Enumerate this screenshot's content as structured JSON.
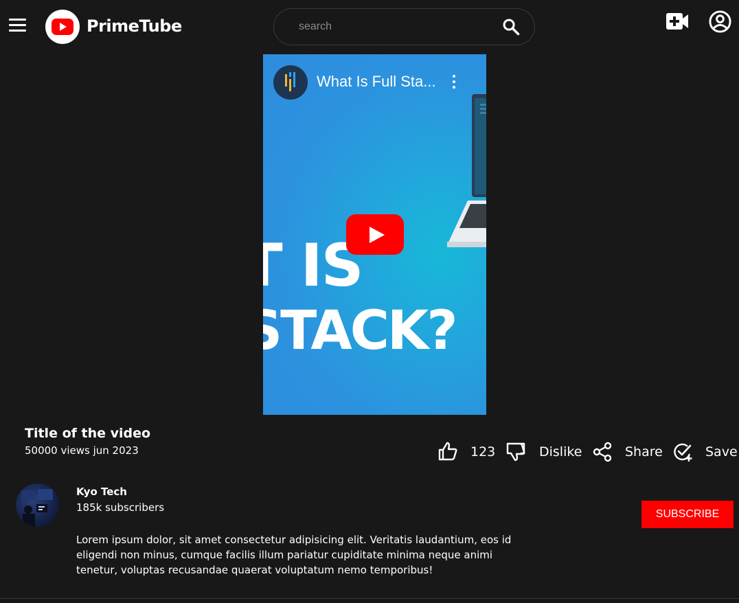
{
  "header": {
    "brand": "PrimeTube",
    "search_placeholder": "search",
    "icons": [
      "menu-icon",
      "logo-icon",
      "search-icon",
      "video-upload-icon",
      "account-circle-icon"
    ]
  },
  "video": {
    "embed_title": "What Is Full Sta...",
    "thumbnail_text_line1": "T IS",
    "thumbnail_text_line2": "STACK?"
  },
  "info": {
    "title": "Title of the video",
    "meta": "50000 views jun 2023"
  },
  "actions": {
    "like_count": "123",
    "dislike_label": "Dislike",
    "share_label": "Share",
    "save_label": "Save"
  },
  "channel": {
    "name": "Kyo Tech",
    "subscribers": "185k subscribers",
    "subscribe_label": "SUBSCRIBE"
  },
  "description": "Lorem ipsum dolor, sit amet consectetur adipisicing elit. Veritatis laudantium, eos id eligendi non minus, cumque facilis illum pariatur cupiditate minima neque animi tenetur, voluptas recusandae quaerat voluptatum nemo temporibus!",
  "colors": {
    "background": "#181818",
    "accent": "#ff0000",
    "video_blue": "#2e8ddd"
  }
}
